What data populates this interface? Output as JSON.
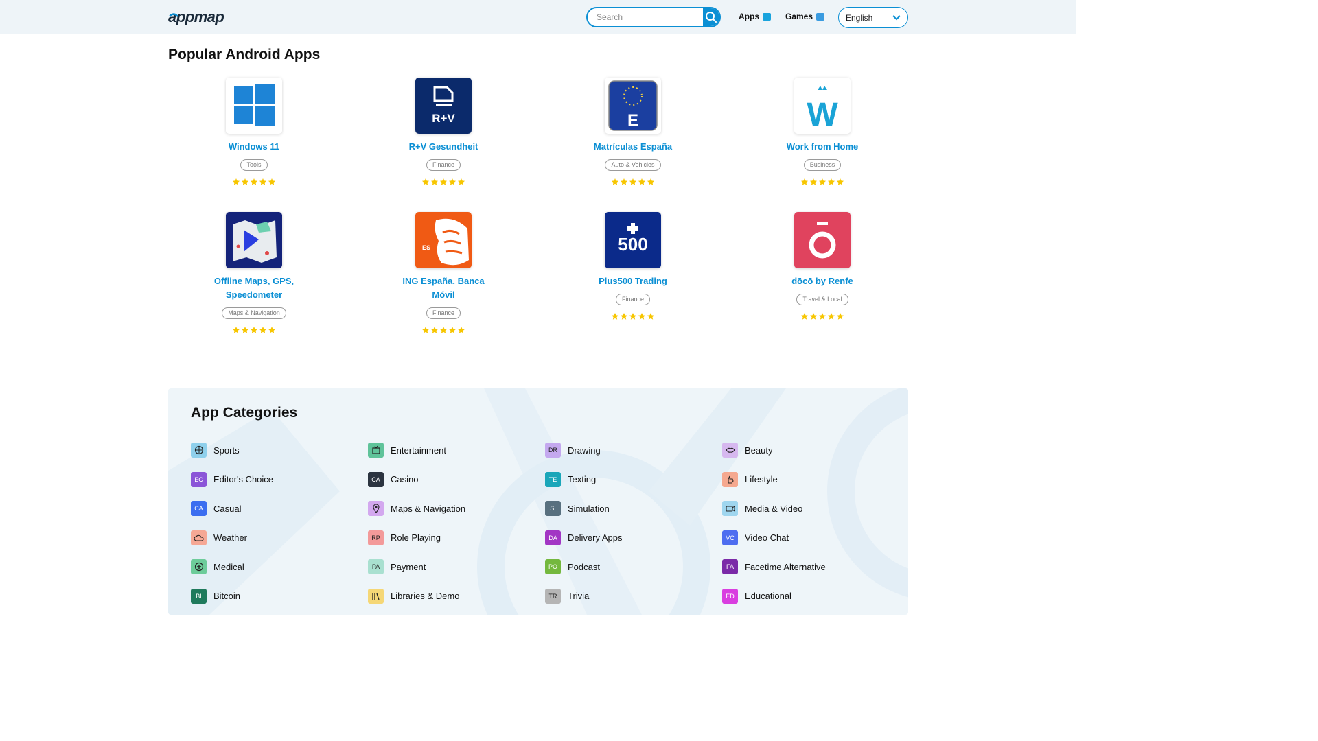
{
  "header": {
    "logo_text": "appmap",
    "search_placeholder": "Search",
    "nav_apps": "Apps",
    "nav_games": "Games",
    "language": "English"
  },
  "popular": {
    "title": "Popular Android Apps",
    "apps": [
      {
        "name": "Windows 11",
        "category": "Tools",
        "rating": 5
      },
      {
        "name": "R+V Gesundheit",
        "category": "Finance",
        "rating": 5
      },
      {
        "name": "Matrículas España",
        "category": "Auto & Vehicles",
        "rating": 5
      },
      {
        "name": "Work from Home",
        "category": "Business",
        "rating": 5
      },
      {
        "name": "Offline Maps, GPS, Speedometer",
        "category": "Maps & Navigation",
        "rating": 5
      },
      {
        "name": "ING España. Banca Móvil",
        "category": "Finance",
        "rating": 5
      },
      {
        "name": "Plus500 Trading",
        "category": "Finance",
        "rating": 5
      },
      {
        "name": "dōcō by Renfe",
        "category": "Travel & Local",
        "rating": 5
      }
    ]
  },
  "categories": {
    "title": "App Categories",
    "items": [
      {
        "label": "Sports",
        "badge": "",
        "icon": "ball-icon",
        "color": "#8fd0ec"
      },
      {
        "label": "Entertainment",
        "badge": "",
        "icon": "tv-icon",
        "color": "#5fc39a"
      },
      {
        "label": "Drawing",
        "badge": "DR",
        "icon": "",
        "color": "#c4a8ef"
      },
      {
        "label": "Beauty",
        "badge": "",
        "icon": "lips-icon",
        "color": "#d6b8ef"
      },
      {
        "label": "Editor's Choice",
        "badge": "EC",
        "icon": "",
        "color": "#8b55d8"
      },
      {
        "label": "Casino",
        "badge": "CA",
        "icon": "",
        "color": "#2b3440"
      },
      {
        "label": "Texting",
        "badge": "TE",
        "icon": "",
        "color": "#1aa6b9"
      },
      {
        "label": "Lifestyle",
        "badge": "",
        "icon": "hand-icon",
        "color": "#f5a88f"
      },
      {
        "label": "Casual",
        "badge": "CA",
        "icon": "",
        "color": "#3b6ef0"
      },
      {
        "label": "Maps & Navigation",
        "badge": "",
        "icon": "pin-icon",
        "color": "#d3a8ef"
      },
      {
        "label": "Simulation",
        "badge": "SI",
        "icon": "",
        "color": "#58707f"
      },
      {
        "label": "Media & Video",
        "badge": "",
        "icon": "video-icon",
        "color": "#9fd6ef"
      },
      {
        "label": "Weather",
        "badge": "",
        "icon": "cloud-icon",
        "color": "#f5a895"
      },
      {
        "label": "Role Playing",
        "badge": "RP",
        "icon": "",
        "color": "#f39a9a"
      },
      {
        "label": "Delivery Apps",
        "badge": "DA",
        "icon": "",
        "color": "#a236c4"
      },
      {
        "label": "Video Chat",
        "badge": "VC",
        "icon": "",
        "color": "#4e6df0"
      },
      {
        "label": "Medical",
        "badge": "",
        "icon": "plus-icon",
        "color": "#6dcc9a"
      },
      {
        "label": "Payment",
        "badge": "PA",
        "icon": "",
        "color": "#a9e0d0"
      },
      {
        "label": "Podcast",
        "badge": "PO",
        "icon": "",
        "color": "#74b83e"
      },
      {
        "label": "Facetime Alternative",
        "badge": "FA",
        "icon": "",
        "color": "#7b2aa8"
      },
      {
        "label": "Bitcoin",
        "badge": "BI",
        "icon": "",
        "color": "#1f7a5c"
      },
      {
        "label": "Libraries & Demo",
        "badge": "",
        "icon": "books-icon",
        "color": "#f5d776"
      },
      {
        "label": "Trivia",
        "badge": "TR",
        "icon": "",
        "color": "#b5b5b5"
      },
      {
        "label": "Educational",
        "badge": "ED",
        "icon": "",
        "color": "#d93ee0"
      }
    ]
  }
}
